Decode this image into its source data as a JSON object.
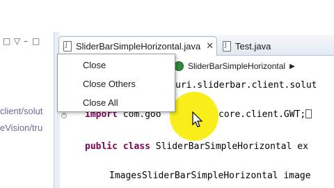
{
  "left_panel": {
    "toolbar_icons": [
      "collapse-icon",
      "view-menu-icon",
      "minimize-icon",
      "maximize-icon"
    ],
    "toolbar_glyphs": [
      "□",
      "▽",
      "–",
      "□"
    ],
    "lines": [
      "client/solut",
      "eVision/tru"
    ]
  },
  "tabs": [
    {
      "label": "SliderBarSimpleHorizontal.java",
      "close": "✕",
      "active": true
    },
    {
      "label": "Test.java",
      "active": false
    }
  ],
  "breadcrumb": {
    "label": "SliderBarSimpleHorizontal",
    "arrow": "▶"
  },
  "context_menu": {
    "items": [
      "Close",
      "Close Others",
      "Close All"
    ],
    "mnemonics": [
      "C",
      "O",
      "A"
    ]
  },
  "code": {
    "line1": "uri.sliderbar.client.solut",
    "line2_kw": "import",
    "line2_a": " com.goo",
    "line2_b": "core.client.GWT;",
    "line3_kw": "public class",
    "line3_rest": " SliderBarSimpleHorizontal ex",
    "line4": "ImagesSliderBarSimpleHorizontal image"
  },
  "colors": {
    "highlight": "#f8ec00",
    "keyword": "#7f0055",
    "tab_border": "#a8b6c8"
  }
}
